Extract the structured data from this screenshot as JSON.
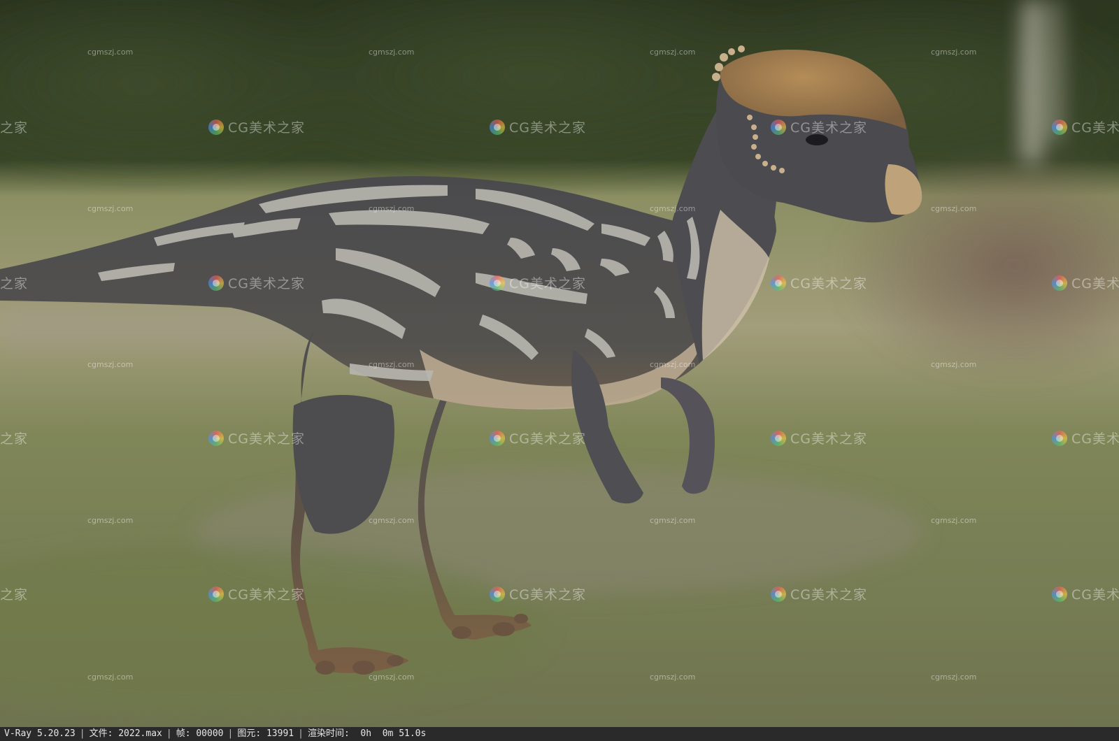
{
  "scene": {
    "subject": "pachycephalosaur-render",
    "colors": {
      "sky_trees": "#2f3a22",
      "grass": "#8e9463",
      "path": "#8f8a7a",
      "body_dark": "#4d4c4f",
      "stripe": "#b9b7b0",
      "dome": "#a07a4c",
      "belly": "#c9b9a0"
    }
  },
  "watermarks": {
    "site": "cgmszj.com",
    "brand": "CG美术之家",
    "brand_cut": "之家",
    "brand_cut_right": "CG美术之"
  },
  "statusbar": {
    "renderer": "V-Ray 5.20.23",
    "file": "文件: 2022.max",
    "frame": "帧: 00000",
    "primitives": "图元: 13991",
    "render_time": "渲染时间:  0h  0m 51.0s"
  }
}
